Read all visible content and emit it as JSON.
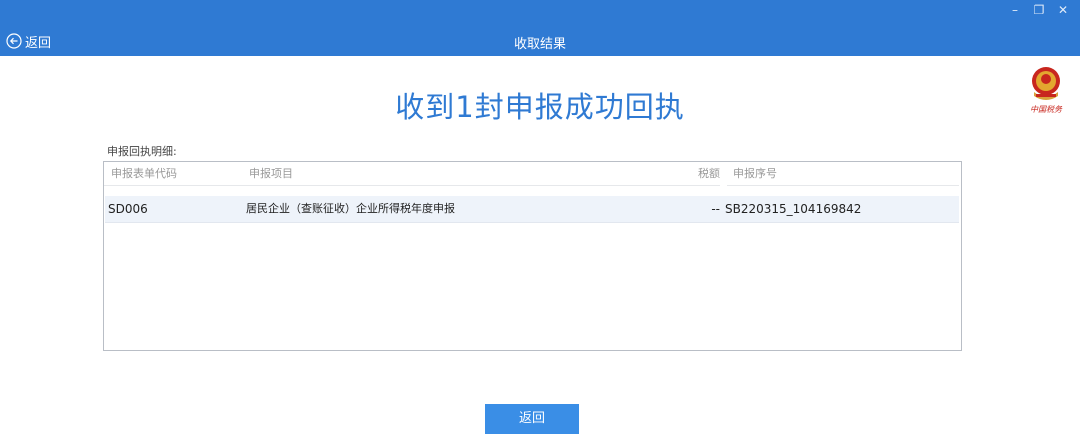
{
  "window": {
    "title": "收取结果",
    "back_label": "返回",
    "controls": {
      "minimize": "–",
      "restore": "❐",
      "close": "✕"
    }
  },
  "emblem": {
    "caption": "中国税务"
  },
  "main": {
    "headline": "收到1封申报成功回执",
    "detail_label": "申报回执明细:"
  },
  "table": {
    "columns": [
      "申报表单代码",
      "申报项目",
      "税额",
      "申报序号"
    ],
    "rows": [
      [
        "SD006",
        "居民企业（查账征收）企业所得税年度申报",
        "--",
        "SB220315_104169842"
      ]
    ]
  },
  "footer": {
    "back_button_label": "返回"
  },
  "colors": {
    "titlebar": "#2f7ad3",
    "headline": "#2f7ad3",
    "button": "#3a8ee6",
    "selected_row": "#eef3fa"
  }
}
